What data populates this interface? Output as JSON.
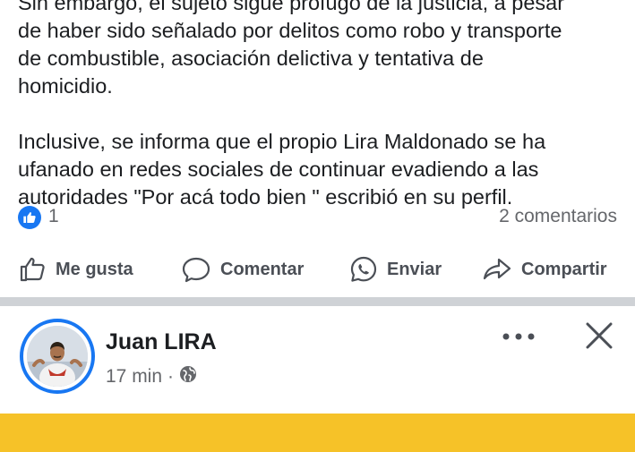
{
  "post": {
    "lines": [
      "Sin embargo, el sujeto sigue prófugo de la justicia, a pesar",
      "de haber sido señalado por delitos como robo y transporte",
      "de combustible, asociación delictiva y tentativa de",
      "homicidio.",
      "Inclusive, se informa que el propio Lira Maldonado se ha",
      "ufanado en redes sociales de continuar evadiendo a las",
      "autoridades \"Por acá todo bien \" escribió en su perfil."
    ],
    "like_count": "1",
    "comments_count": "2 comentarios"
  },
  "actions": {
    "like": "Me gusta",
    "comment": "Comentar",
    "send": "Enviar",
    "share": "Compartir"
  },
  "post2": {
    "author": "Juan LIRA",
    "time": "17 min",
    "separator": "·",
    "privacy_icon": "globe-icon"
  },
  "colors": {
    "facebook_blue": "#1877f2",
    "text_primary": "#1c1e21",
    "text_secondary": "#65676b",
    "separator": "#cfd2d6",
    "banner_yellow": "#f6c228"
  }
}
